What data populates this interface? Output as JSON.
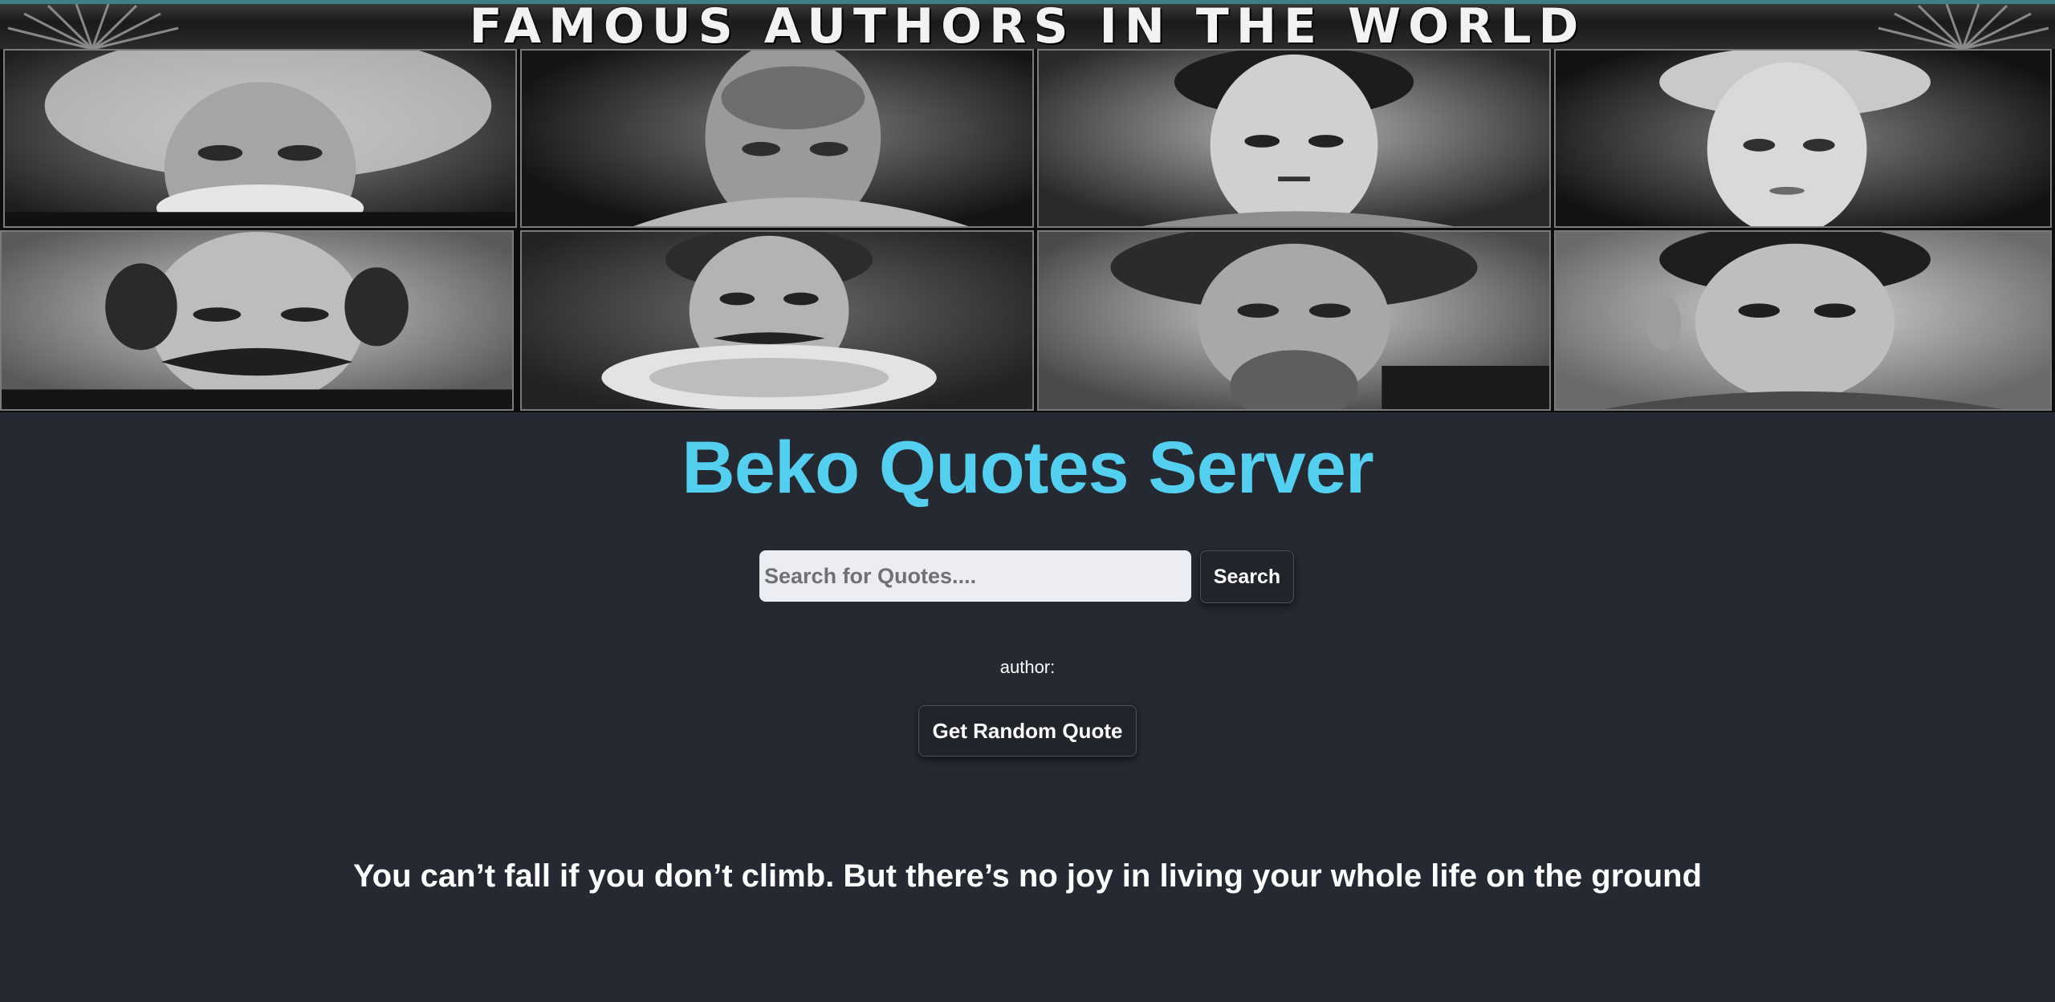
{
  "banner": {
    "title": "FAMOUS AUTHORS IN THE WORLD",
    "portraits": [
      {
        "icon": "author-portrait-white-hair-mustache"
      },
      {
        "icon": "author-portrait-ruff-collar"
      },
      {
        "icon": "author-portrait-dark-hair"
      },
      {
        "icon": "author-portrait-bonnet"
      },
      {
        "icon": "author-portrait-mustache-balding"
      },
      {
        "icon": "author-portrait-ruff-goatee"
      },
      {
        "icon": "author-portrait-bearded"
      },
      {
        "icon": "author-portrait-young-man"
      }
    ]
  },
  "app": {
    "title": "Beko Quotes Server"
  },
  "search": {
    "placeholder": "Search for Quotes....",
    "value": "",
    "button_label": "Search"
  },
  "author": {
    "label": "author:"
  },
  "random": {
    "button_label": "Get Random Quote"
  },
  "quote": {
    "text": "You can’t fall if you don’t climb. But there’s no joy in living your whole life on the ground"
  },
  "colors": {
    "background": "#252932",
    "title_accent": "#55cfef",
    "button_bg": "#22242b",
    "input_bg": "#ebedf2"
  }
}
